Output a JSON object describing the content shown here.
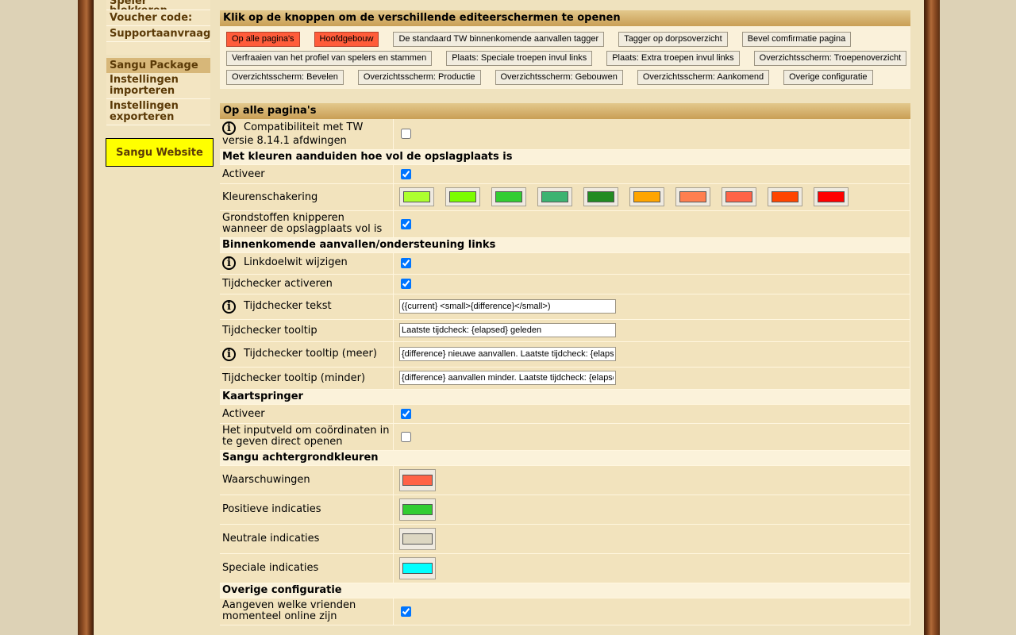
{
  "sidebar": {
    "items_top": [
      {
        "label": "Speler blokkeren"
      },
      {
        "label": "Voucher code:"
      },
      {
        "label": "Supportaanvraag"
      }
    ],
    "package_title": "Sangu Package",
    "items_bottom": [
      {
        "label": "Instellingen importeren"
      },
      {
        "label": "Instellingen exporteren"
      }
    ],
    "website_button": "Sangu Website"
  },
  "editor": {
    "title": "Klik op de knoppen om de verschillende editeerschermen te openen",
    "buttons": [
      {
        "label": "Op alle pagina's",
        "active": true
      },
      {
        "label": "Hoofdgebouw",
        "active": true
      },
      {
        "label": "De standaard TW binnenkomende aanvallen tagger"
      },
      {
        "label": "Tagger op dorpsoverzicht"
      },
      {
        "label": "Bevel comfirmatie pagina"
      },
      {
        "label": "Verfraaien van het profiel van spelers en stammen"
      },
      {
        "label": "Plaats: Speciale troepen invul links"
      },
      {
        "label": "Plaats: Extra troepen invul links"
      },
      {
        "label": "Overzichtsscherm: Troepenoverzicht"
      },
      {
        "label": "Overzichtsscherm: Bevelen"
      },
      {
        "label": "Overzichtsscherm: Productie"
      },
      {
        "label": "Overzichtsscherm: Gebouwen"
      },
      {
        "label": "Overzichtsscherm: Aankomend"
      },
      {
        "label": "Overige configuratie"
      }
    ]
  },
  "settings": {
    "title": "Op alle pagina's",
    "compat": {
      "label": "Compatibiliteit met TW versie 8.14.1 afdwingen",
      "checked": false
    },
    "storage": {
      "title": "Met kleuren aanduiden hoe vol de opslagplaats is",
      "activate": {
        "label": "Activeer",
        "checked": true
      },
      "gradient": {
        "label": "Kleurenschakering",
        "colors": [
          "#adff2f",
          "#7cfc00",
          "#32cd32",
          "#3cb371",
          "#228b22",
          "#ffa500",
          "#ff7f50",
          "#ff6347",
          "#ff4500",
          "#ff0000"
        ]
      },
      "blink": {
        "label": "Grondstoffen knipperen wanneer de opslagplaats vol is",
        "checked": true
      }
    },
    "incoming": {
      "title": "Binnenkomende aanvallen/ondersteuning links",
      "linktarget": {
        "label": "Linkdoelwit wijzigen",
        "checked": true
      },
      "timecheck": {
        "label": "Tijdchecker activeren",
        "checked": true
      },
      "timetext": {
        "label": "Tijdchecker tekst",
        "value": "({current} <small>{difference}</small>)"
      },
      "tooltip": {
        "label": "Tijdchecker tooltip",
        "value": "Laatste tijdcheck: {elapsed} geleden"
      },
      "tooltip_more": {
        "label": "Tijdchecker tooltip (meer)",
        "value": "{difference} nieuwe aanvallen. Laatste tijdcheck: {elapsed} geleden"
      },
      "tooltip_less": {
        "label": "Tijdchecker tooltip (minder)",
        "value": "{difference} aanvallen minder. Laatste tijdcheck: {elapsed} geleden"
      }
    },
    "mapjumper": {
      "title": "Kaartspringer",
      "activate": {
        "label": "Activeer",
        "checked": true
      },
      "direct": {
        "label": "Het inputveld om coördinaten in te geven direct openen",
        "checked": false
      }
    },
    "bgcolors": {
      "title": "Sangu achtergrondkleuren",
      "warnings": {
        "label": "Waarschuwingen",
        "color": "#ff6347"
      },
      "positive": {
        "label": "Positieve indicaties",
        "color": "#32cd32"
      },
      "neutral": {
        "label": "Neutrale indicaties",
        "color": "#ddd7c2"
      },
      "special": {
        "label": "Speciale indicaties",
        "color": "#00ffff"
      }
    },
    "other": {
      "title": "Overige configuratie",
      "friends": {
        "label": "Aangeven welke vrienden momenteel online zijn",
        "checked": true
      }
    }
  }
}
